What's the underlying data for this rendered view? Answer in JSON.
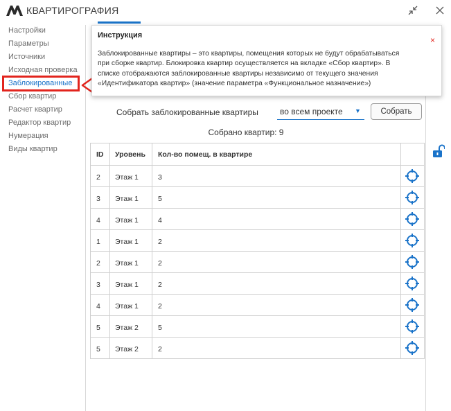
{
  "app": {
    "title": "КВАРТИРОГРАФИЯ"
  },
  "sidebar": {
    "items": [
      {
        "label": "Настройки"
      },
      {
        "label": "Параметры"
      },
      {
        "label": "Источники"
      },
      {
        "label": "Исходная проверка"
      },
      {
        "label": "Заблокированные",
        "active": true
      },
      {
        "label": "Сбор квартир"
      },
      {
        "label": "Расчет квартир"
      },
      {
        "label": "Редактор квартир"
      },
      {
        "label": "Нумерация"
      },
      {
        "label": "Виды квартир"
      }
    ]
  },
  "instruction": {
    "title": "Инструкция",
    "close_glyph": "×",
    "line1": "Заблокированные квартиры – это квартиры, помещения которых не будут обрабатываться",
    "line2": "при сборке квартир. Блокировка квартир осуществляется на вкладке «Сбор квартир». В",
    "line3": "списке отображаются заблокированные квартиры независимо от текущего значения",
    "line4": "«Идентификатора квартир» (значение параметра «Функциональное назначение»)"
  },
  "controls": {
    "collect_label": "Собрать заблокированные квартиры",
    "scope_value": "во всем проекте",
    "collect_button": "Собрать",
    "count_text": "Собрано квартир: 9"
  },
  "table": {
    "headers": [
      "ID",
      "Уровень",
      "Кол-во помещ. в квартире"
    ],
    "rows": [
      {
        "id": "2",
        "level": "Этаж 1",
        "rooms": "3"
      },
      {
        "id": "3",
        "level": "Этаж 1",
        "rooms": "5"
      },
      {
        "id": "4",
        "level": "Этаж 1",
        "rooms": "4"
      },
      {
        "id": "1",
        "level": "Этаж 1",
        "rooms": "2"
      },
      {
        "id": "2",
        "level": "Этаж 1",
        "rooms": "2"
      },
      {
        "id": "3",
        "level": "Этаж 1",
        "rooms": "2"
      },
      {
        "id": "4",
        "level": "Этаж 1",
        "rooms": "2"
      },
      {
        "id": "5",
        "level": "Этаж 2",
        "rooms": "5"
      },
      {
        "id": "5",
        "level": "Этаж 2",
        "rooms": "2"
      }
    ],
    "row_action_icon": "crosshair-target-icon"
  },
  "icons": {
    "logo": "app-logo-icon",
    "collapse": "collapse-arrows-icon",
    "close": "close-icon",
    "lock": "unlock-icon",
    "annotation": "red-arrow-icon"
  },
  "colors": {
    "accent": "#1a73c9",
    "highlight_red": "#e2241d",
    "text": "#333333",
    "muted": "#6b6b6b",
    "border": "#cfcfcf"
  }
}
